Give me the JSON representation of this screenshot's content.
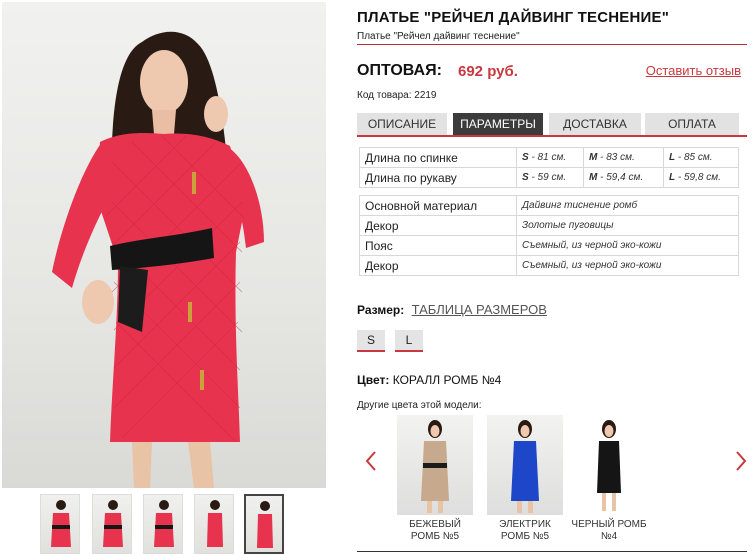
{
  "product": {
    "title": "ПЛАТЬЕ \"РЕЙЧЕЛ ДАЙВИНГ ТЕСНЕНИЕ\"",
    "subtitle": "Платье \"Рейчел дайвинг теснение\"",
    "price_label": "ОПТОВАЯ:",
    "price_value": "692 руб.",
    "review_link": "Оставить отзыв",
    "sku": "Код товара: 2219"
  },
  "tabs": [
    {
      "label": "ОПИСАНИЕ"
    },
    {
      "label": "ПАРАМЕТРЫ"
    },
    {
      "label": "ДОСТАВКА"
    },
    {
      "label": "ОПЛАТА"
    }
  ],
  "measurements": [
    {
      "name": "Длина по спинке",
      "s": "S",
      "s_val": " - 81 см.",
      "m": "M",
      "m_val": " - 83 см.",
      "l": "L",
      "l_val": " - 85 см."
    },
    {
      "name": "Длина по рукаву",
      "s": "S",
      "s_val": " - 59 см.",
      "m": "M",
      "m_val": " - 59,4 см.",
      "l": "L",
      "l_val": " - 59,8 см."
    }
  ],
  "attributes": [
    {
      "name": "Основной материал",
      "value": "Дайвинг тиснение ромб"
    },
    {
      "name": "Декор",
      "value": "Золотые пуговицы"
    },
    {
      "name": "Пояс",
      "value": "Съемный, из черной эко-кожи"
    },
    {
      "name": "Декор",
      "value": "Съемный, из черной эко-кожи"
    }
  ],
  "size": {
    "label": "Размер:",
    "link": "ТАБЛИЦА РАЗМЕРОВ",
    "options": [
      "S",
      "L"
    ]
  },
  "color": {
    "label": "Цвет:",
    "value": "КОРАЛЛ РОМБ №4",
    "other_label": "Другие цвета этой модели:"
  },
  "variants": [
    {
      "line1": "БЕЖЕВЫЙ",
      "line2": "РОМБ №5",
      "dress_color": "#c7a98e"
    },
    {
      "line1": "ЭЛЕКТРИК",
      "line2": "РОМБ №5",
      "dress_color": "#1e46c8"
    },
    {
      "line1": "ЧЕРНЫЙ РОМБ",
      "line2": "№4",
      "dress_color": "#151515"
    }
  ],
  "colors": {
    "accent": "#c7393f",
    "dress": "#e8334f",
    "tab_active": "#3c3c3c"
  },
  "icons": {
    "prev": "chevron-left-icon",
    "next": "chevron-right-icon"
  }
}
